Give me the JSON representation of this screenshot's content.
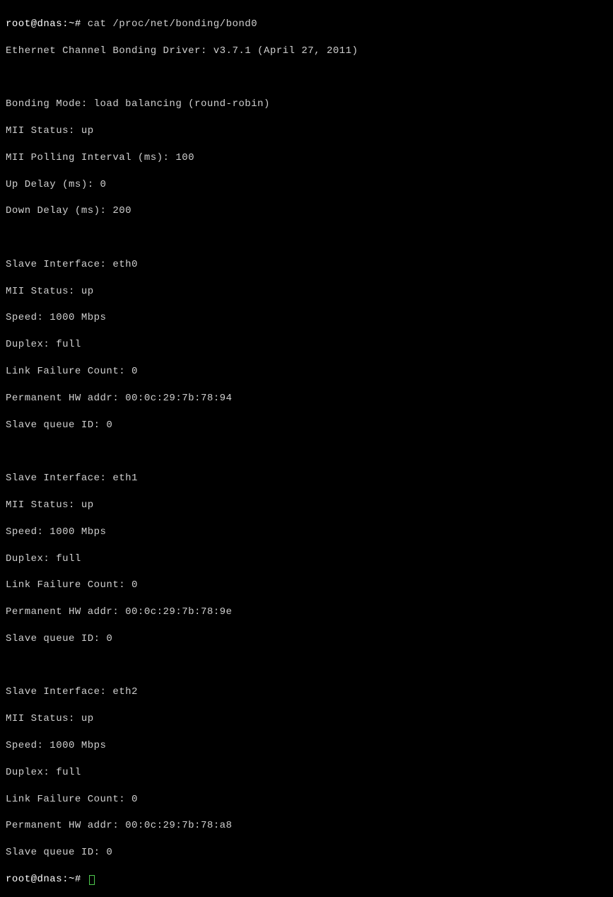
{
  "prompt1": "root@dnas:~#",
  "command": "cat /proc/net/bonding/bond0",
  "header": {
    "driver": "Ethernet Channel Bonding Driver: v3.7.1 (April 27, 2011)"
  },
  "bonding": {
    "mode": "Bonding Mode: load balancing (round-robin)",
    "mii_status": "MII Status: up",
    "mii_polling": "MII Polling Interval (ms): 100",
    "up_delay": "Up Delay (ms): 0",
    "down_delay": "Down Delay (ms): 200"
  },
  "slaves": [
    {
      "iface": "Slave Interface: eth0",
      "mii": "MII Status: up",
      "speed": "Speed: 1000 Mbps",
      "duplex": "Duplex: full",
      "failures": "Link Failure Count: 0",
      "hwaddr": "Permanent HW addr: 00:0c:29:7b:78:94",
      "queue": "Slave queue ID: 0"
    },
    {
      "iface": "Slave Interface: eth1",
      "mii": "MII Status: up",
      "speed": "Speed: 1000 Mbps",
      "duplex": "Duplex: full",
      "failures": "Link Failure Count: 0",
      "hwaddr": "Permanent HW addr: 00:0c:29:7b:78:9e",
      "queue": "Slave queue ID: 0"
    },
    {
      "iface": "Slave Interface: eth2",
      "mii": "MII Status: up",
      "speed": "Speed: 1000 Mbps",
      "duplex": "Duplex: full",
      "failures": "Link Failure Count: 0",
      "hwaddr": "Permanent HW addr: 00:0c:29:7b:78:a8",
      "queue": "Slave queue ID: 0"
    }
  ],
  "prompt2": "root@dnas:~#"
}
